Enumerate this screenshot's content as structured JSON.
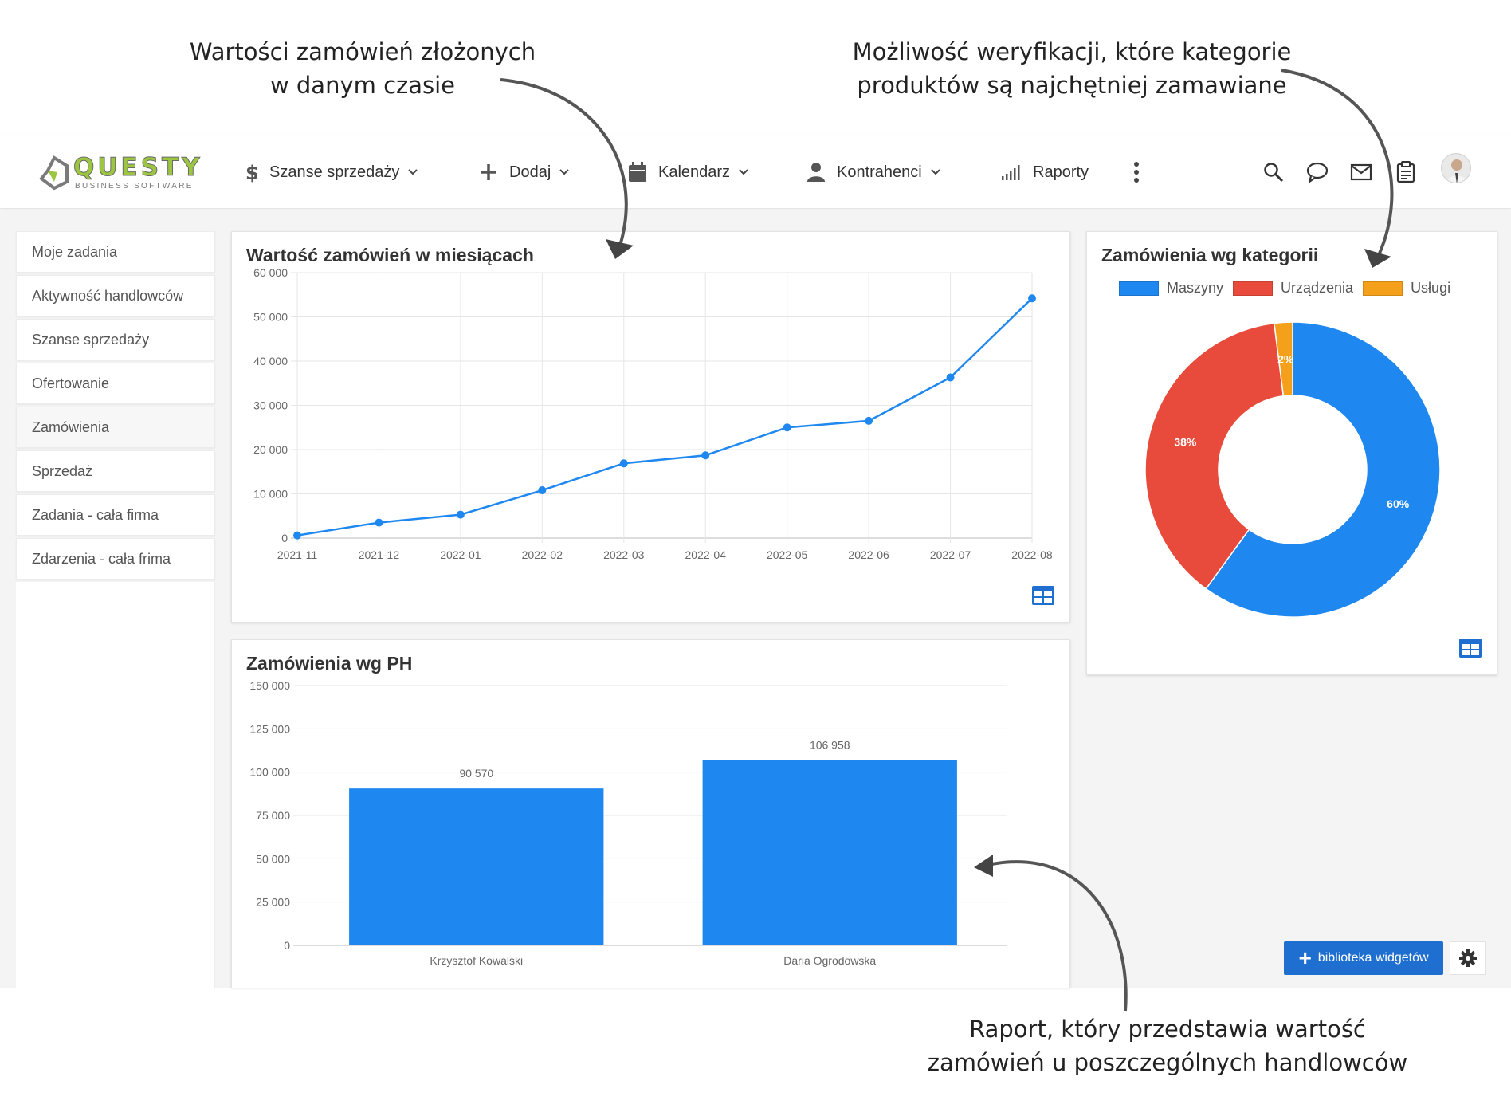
{
  "annotations": {
    "top_left": [
      "Wartości zamówień złożonych",
      "w danym czasie"
    ],
    "top_right": [
      "Możliwość weryfikacji, które kategorie",
      "produktów są najchętniej zamawiane"
    ],
    "bottom_right": [
      "Raport, który przedstawia wartość",
      "zamówień u poszczególnych handlowców"
    ]
  },
  "logo": {
    "name": "QUESTY",
    "tagline": "BUSINESS SOFTWARE"
  },
  "nav": {
    "items": [
      {
        "label": "Szanse sprzedaży",
        "icon": "dollar-icon"
      },
      {
        "label": "Dodaj",
        "icon": "plus-icon"
      },
      {
        "label": "Kalendarz",
        "icon": "calendar-icon"
      },
      {
        "label": "Kontrahenci",
        "icon": "person-icon"
      },
      {
        "label": "Raporty",
        "icon": "signal-bars-icon"
      }
    ],
    "tools": [
      "search-icon",
      "chat-icon",
      "mail-icon",
      "clipboard-icon"
    ]
  },
  "sidebar": {
    "items": [
      "Moje zadania",
      "Aktywność handlowców",
      "Szanse sprzedaży",
      "Ofertowanie",
      "Zamówienia",
      "Sprzedaż",
      "Zadania - cała firma",
      "Zdarzenia - cała frima"
    ],
    "active": "Zamówienia"
  },
  "cards": {
    "line_title": "Wartość zamówień w miesiącach",
    "bar_title": "Zamówienia wg PH",
    "donut_title": "Zamówienia wg kategorii"
  },
  "buttons": {
    "widgets": "biblioteka widgetów"
  },
  "colors": {
    "blue": "#1e88f0",
    "red": "#e84a3c",
    "orange": "#f5a01a",
    "brand_green": "#9cc640"
  },
  "chart_data": [
    {
      "type": "line",
      "title": "Wartość zamówień w miesiącach",
      "x": [
        "2021-11",
        "2021-12",
        "2022-01",
        "2022-02",
        "2022-03",
        "2022-04",
        "2022-05",
        "2022-06",
        "2022-07",
        "2022-08"
      ],
      "values": [
        600,
        3500,
        5300,
        10800,
        16900,
        18700,
        25000,
        26500,
        36300,
        54200
      ],
      "ylim": [
        0,
        60000
      ],
      "yticks": [
        "0",
        "10 000",
        "20 000",
        "30 000",
        "40 000",
        "50 000",
        "60 000"
      ],
      "grid": true
    },
    {
      "type": "bar",
      "title": "Zamówienia wg PH",
      "categories": [
        "Krzysztof Kowalski",
        "Daria Ogrodowska"
      ],
      "values": [
        90570,
        106958
      ],
      "data_labels": [
        "90 570",
        "106 958"
      ],
      "ylim": [
        0,
        150000
      ],
      "yticks": [
        "0",
        "25 000",
        "50 000",
        "75 000",
        "100 000",
        "125 000",
        "150 000"
      ],
      "grid": true
    },
    {
      "type": "pie",
      "title": "Zamówienia wg kategorii",
      "labels": [
        "Maszyny",
        "Urządzenia",
        "Usługi"
      ],
      "values": [
        60,
        38,
        2
      ],
      "data_labels": [
        "60%",
        "38%",
        "2%"
      ],
      "legend": "top"
    }
  ]
}
